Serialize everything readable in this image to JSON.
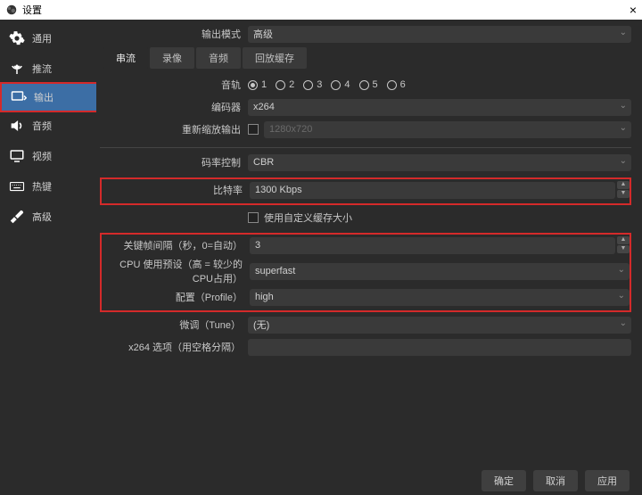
{
  "window": {
    "title": "设置"
  },
  "sidebar": {
    "items": [
      {
        "label": "通用"
      },
      {
        "label": "推流"
      },
      {
        "label": "输出"
      },
      {
        "label": "音频"
      },
      {
        "label": "视频"
      },
      {
        "label": "热键"
      },
      {
        "label": "高级"
      }
    ]
  },
  "output_mode": {
    "label": "输出模式",
    "value": "高级"
  },
  "tabs": {
    "stream": "串流",
    "record": "录像",
    "audio": "音频",
    "replay": "回放缓存"
  },
  "audio_track": {
    "label": "音轨",
    "options": [
      "1",
      "2",
      "3",
      "4",
      "5",
      "6"
    ],
    "selected": "1"
  },
  "encoder": {
    "label": "编码器",
    "value": "x264"
  },
  "rescale": {
    "label": "重新缩放输出",
    "checked": false,
    "value": "1280x720"
  },
  "rate_control": {
    "label": "码率控制",
    "value": "CBR"
  },
  "bitrate": {
    "label": "比特率",
    "value": "1300 Kbps"
  },
  "custom_buffer": {
    "label": "使用自定义缓存大小",
    "checked": false
  },
  "keyframe": {
    "label": "关键帧间隔（秒，0=自动）",
    "value": "3"
  },
  "cpu_preset": {
    "label": "CPU 使用预设（高 = 较少的 CPU占用）",
    "value": "superfast"
  },
  "profile": {
    "label": "配置（Profile）",
    "value": "high"
  },
  "tune": {
    "label": "微调（Tune）",
    "value": "(无)"
  },
  "x264opts": {
    "label": "x264 选项（用空格分隔）",
    "value": ""
  },
  "buttons": {
    "ok": "确定",
    "cancel": "取消",
    "apply": "应用"
  }
}
